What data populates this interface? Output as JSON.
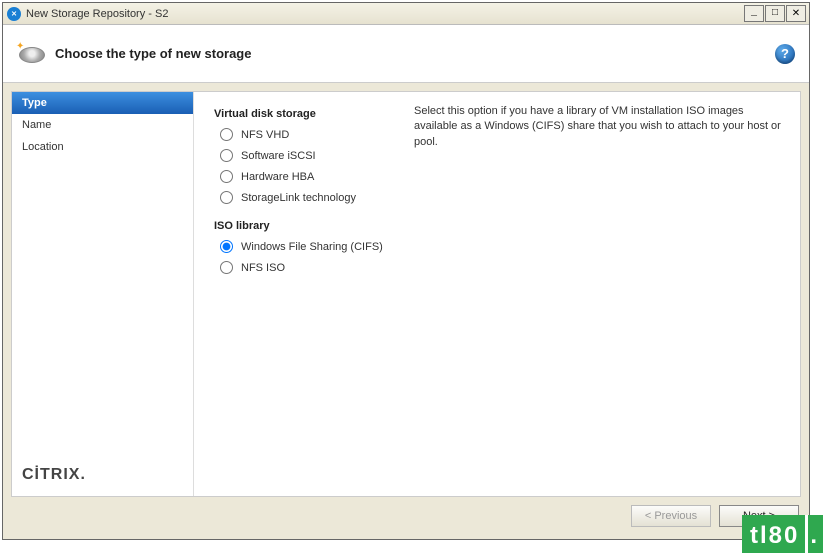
{
  "window": {
    "title": "New Storage Repository - S2"
  },
  "header": {
    "title": "Choose the type of new storage"
  },
  "sidebar": {
    "items": [
      {
        "label": "Type",
        "selected": true
      },
      {
        "label": "Name",
        "selected": false
      },
      {
        "label": "Location",
        "selected": false
      }
    ],
    "brand": "CİTRIX"
  },
  "sections": {
    "virtual_disk_label": "Virtual disk storage",
    "iso_library_label": "ISO library",
    "virtual_disk_options": [
      {
        "label": "NFS VHD",
        "selected": false
      },
      {
        "label": "Software iSCSI",
        "selected": false
      },
      {
        "label": "Hardware HBA",
        "selected": false
      },
      {
        "label": "StorageLink technology",
        "selected": false
      }
    ],
    "iso_library_options": [
      {
        "label": "Windows File Sharing (CIFS)",
        "selected": true
      },
      {
        "label": "NFS ISO",
        "selected": false
      }
    ]
  },
  "description": "Select this option if you have a library of VM installation ISO images available as a Windows (CIFS) share that you wish to attach to your host or pool.",
  "footer": {
    "previous": "< Previous",
    "next": "Next >"
  },
  "watermark": "tl80"
}
